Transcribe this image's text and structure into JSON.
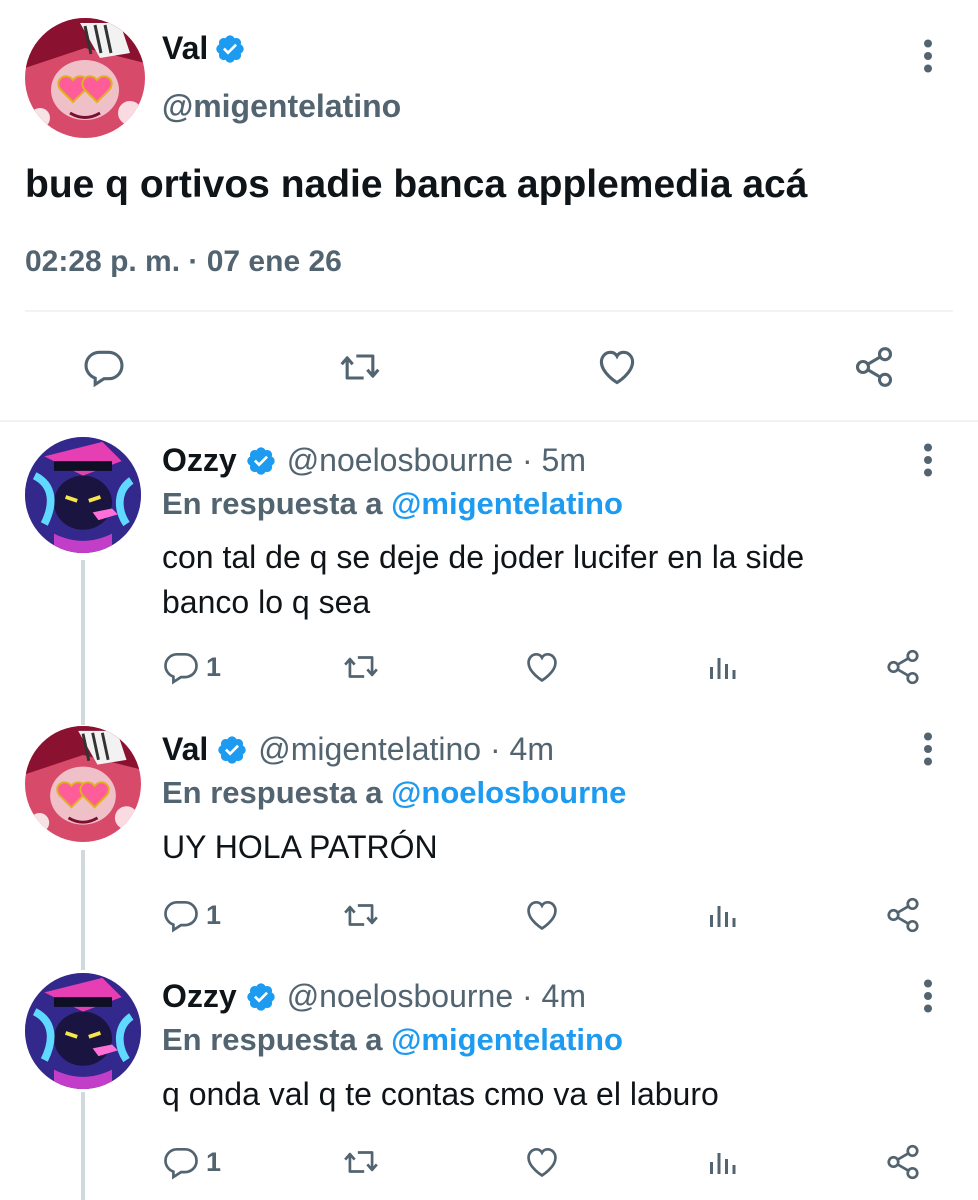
{
  "main_tweet": {
    "name": "Val",
    "handle": "@migentelatino",
    "text": "bue q ortivos nadie banca applemedia acá",
    "timestamp": "02:28 p. m. · 07 ene 26"
  },
  "reply_label": "En respuesta a",
  "replies": [
    {
      "name": "Ozzy",
      "handle_time": "@noelosbourne · 5m",
      "reply_to": "@migentelatino",
      "text_lines": [
        "con tal de q se deje de joder lucifer en la side",
        "banco lo q sea"
      ],
      "reply_count": "1"
    },
    {
      "name": "Val",
      "handle_time": "@migentelatino · 4m",
      "reply_to": "@noelosbourne",
      "text_lines": [
        "UY HOLA PATRÓN"
      ],
      "reply_count": "1"
    },
    {
      "name": "Ozzy",
      "handle_time": "@noelosbourne · 4m",
      "reply_to": "@migentelatino",
      "text_lines": [
        "q onda val q te contas cmo va el laburo"
      ],
      "reply_count": "1"
    }
  ],
  "icons": {
    "verified": "verified-badge-icon",
    "more": "more-vertical-icon",
    "reply": "reply-icon",
    "retweet": "retweet-icon",
    "like": "heart-icon",
    "views": "views-icon",
    "share": "share-icon"
  },
  "colors": {
    "accent": "#1d9bf0",
    "secondary_text": "#536471",
    "divider": "#eff3f4"
  }
}
